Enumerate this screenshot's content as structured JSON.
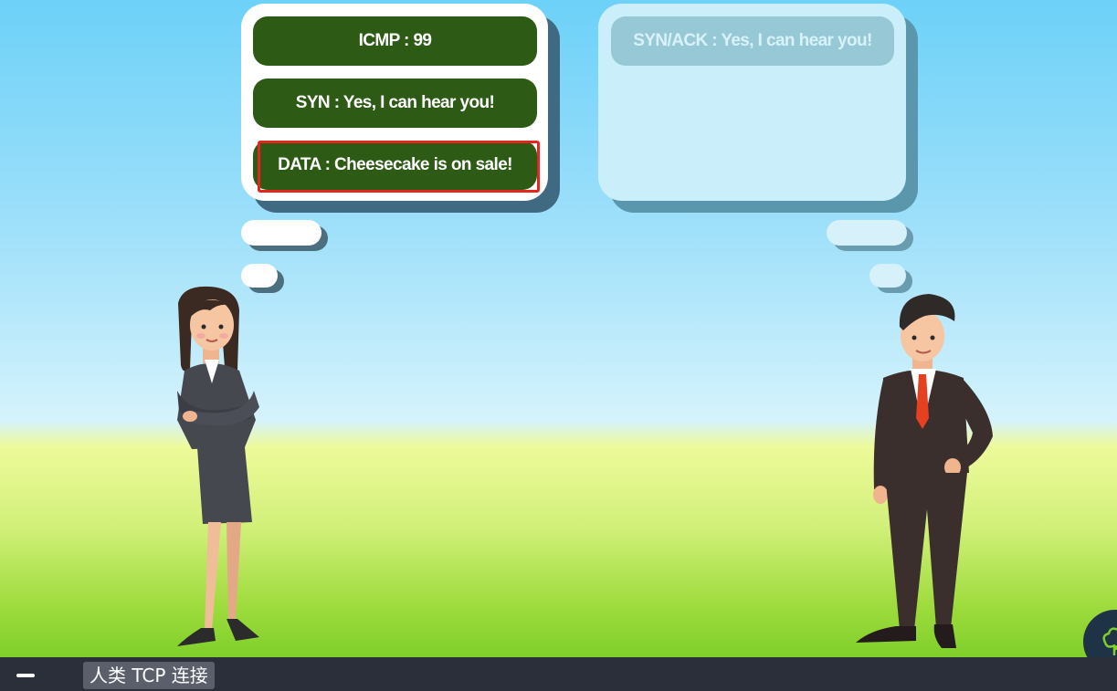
{
  "left_bubble": {
    "messages": [
      {
        "label": "ICMP : 99"
      },
      {
        "label": "SYN : Yes, I can hear you!"
      },
      {
        "label": "DATA : Cheesecake is on sale!"
      }
    ]
  },
  "right_bubble": {
    "messages": [
      {
        "label": "SYN/ACK : Yes, I can hear you!"
      }
    ]
  },
  "taskbar": {
    "app_label": "人类 TCP 连接"
  },
  "icons": {
    "minimize": "minimize-icon",
    "corner": "cloud-tree-icon"
  },
  "colors": {
    "message_green": "#2d5a14",
    "highlight_red": "#e3271f",
    "taskbar_bg": "#2b2f3a"
  }
}
